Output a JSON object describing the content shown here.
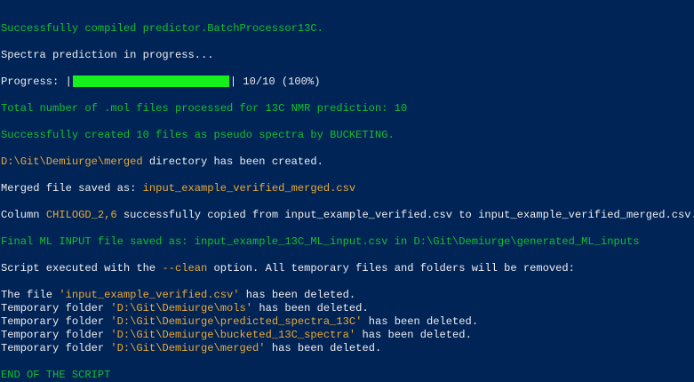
{
  "colors": {
    "background": "#012456",
    "text": "#eeedf0",
    "success_green": "#13c02e",
    "highlight_orange": "#e9a93a",
    "progress_fill": "#16f11b"
  },
  "lines": {
    "compiled": "Successfully compiled predictor.BatchProcessor13C.",
    "prediction_in_progress": "Spectra prediction in progress...",
    "progress": {
      "label": "Progress: |",
      "fraction": 1.0,
      "suffix": "| 10/10 (100%)"
    },
    "total_processed": "Total number of .mol files processed for 13C NMR prediction: 10",
    "bucketing": "Successfully created 10 files as pseudo spectra by BUCKETING.",
    "dir_created": {
      "path": "D:\\Git\\Demiurge\\merged",
      "rest": " directory has been created."
    },
    "merged_saved": {
      "prefix": "Merged file saved as: ",
      "file": "input_example_verified_merged.csv"
    },
    "column_copied": {
      "prefix": "Column ",
      "column": "CHILOGD_2,6",
      "rest": " successfully copied from input_example_verified.csv to input_example_verified_merged.csv."
    },
    "final_ml_input": "Final ML INPUT file saved as: input_example_13C_ML_input.csv in D:\\Git\\Demiurge\\generated_ML_inputs",
    "script_clean": {
      "prefix": "Script executed with the ",
      "option": "--clean",
      "rest": " option. All temporary files and folders will be removed:"
    },
    "deleted": [
      {
        "prefix": "The file ",
        "path": "'input_example_verified.csv'",
        "rest": " has been deleted."
      },
      {
        "prefix": "Temporary folder ",
        "path": "'D:\\Git\\Demiurge\\mols'",
        "rest": " has been deleted."
      },
      {
        "prefix": "Temporary folder ",
        "path": "'D:\\Git\\Demiurge\\predicted_spectra_13C'",
        "rest": " has been deleted."
      },
      {
        "prefix": "Temporary folder ",
        "path": "'D:\\Git\\Demiurge\\bucketed_13C_spectra'",
        "rest": " has been deleted."
      },
      {
        "prefix": "Temporary folder ",
        "path": "'D:\\Git\\Demiurge\\merged'",
        "rest": " has been deleted."
      }
    ],
    "end": "END OF THE SCRIPT"
  }
}
